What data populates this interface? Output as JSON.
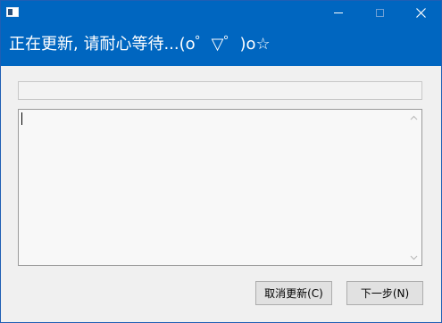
{
  "window": {
    "icon": "app-icon",
    "controls": {
      "minimize": "minimize-icon",
      "maximize": "maximize-icon",
      "close": "close-icon"
    }
  },
  "header": {
    "title": "正在更新, 请耐心等待...(o゜▽゜)o☆",
    "background_color": "#0066c0"
  },
  "progress": {
    "value": 0
  },
  "log": {
    "text": ""
  },
  "buttons": {
    "cancel_label": "取消更新(C)",
    "next_label": "下一步(N)"
  }
}
